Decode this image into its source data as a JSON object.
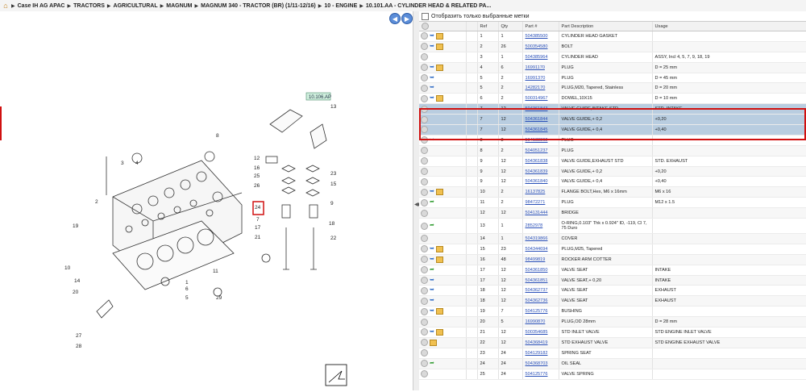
{
  "breadcrumb": {
    "items": [
      "Case IH AG APAC",
      "TRACTORS",
      "AGRICULTURAL",
      "MAGNUM",
      "MAGNUM 340 - TRACTOR (BR) (1/11-12/16)",
      "10 - ENGINE",
      "10.101.AA - CYLINDER HEAD & RELATED PA..."
    ]
  },
  "diagram": {
    "ref_label": "10.106.AP",
    "callouts": [
      "1",
      "2",
      "3",
      "4",
      "5",
      "6",
      "7",
      "8",
      "9",
      "10",
      "11",
      "12",
      "13",
      "14",
      "15",
      "16",
      "17",
      "18",
      "19",
      "20",
      "21",
      "22",
      "23",
      "24",
      "25",
      "26",
      "27",
      "28",
      "29"
    ]
  },
  "right": {
    "filter_label": "Отобразить только выбранные метки",
    "columns": [
      "Ref",
      "Qty",
      "Part #",
      "Part Description",
      "Usage"
    ],
    "rows": [
      {
        "ref": "1",
        "qty": "1",
        "part": "504385500",
        "desc": "CYLINDER HEAD GASKET",
        "usage": "",
        "icons": [
          "arrow",
          "box"
        ]
      },
      {
        "ref": "2",
        "qty": "26",
        "part": "500354580",
        "desc": "BOLT",
        "usage": "",
        "icons": [
          "arrow",
          "box"
        ]
      },
      {
        "ref": "3",
        "qty": "1",
        "part": "504385964",
        "desc": "CYLINDER HEAD",
        "usage": "ASSY, Incl 4, 5, 7, 9, 18, 19",
        "icons": []
      },
      {
        "ref": "4",
        "qty": "6",
        "part": "16991170",
        "desc": "PLUG",
        "usage": "D = 25 mm",
        "icons": [
          "arrow",
          "box"
        ]
      },
      {
        "ref": "5",
        "qty": "2",
        "part": "16991370",
        "desc": "PLUG",
        "usage": "D = 45 mm",
        "icons": [
          "arrow"
        ]
      },
      {
        "ref": "5",
        "qty": "2",
        "part": "14282170",
        "desc": "PLUG,M20, Tapered, Stainless",
        "usage": "D = 20 mm",
        "icons": [
          "arrow"
        ]
      },
      {
        "ref": "6",
        "qty": "2",
        "part": "500314967",
        "desc": "DOWEL,10X15",
        "usage": "D = 10 mm",
        "icons": [
          "arrow",
          "box"
        ]
      },
      {
        "ref": "7",
        "qty": "12",
        "part": "504361843",
        "desc": "VALVE GUIDE,INTAKE STD",
        "usage": "STD. INTAKE",
        "icons": [],
        "sel": true
      },
      {
        "ref": "7",
        "qty": "12",
        "part": "504361844",
        "desc": "VALVE GUIDE,+ 0,2",
        "usage": "+0,20",
        "icons": [],
        "sel": true
      },
      {
        "ref": "7",
        "qty": "12",
        "part": "504361845",
        "desc": "VALVE GUIDE,+ 0,4",
        "usage": "+0,40",
        "icons": [],
        "sel": true
      },
      {
        "ref": "8",
        "qty": "3",
        "part": "504138862",
        "desc": "PLUG",
        "usage": "",
        "icons": [
          "arrow"
        ]
      },
      {
        "ref": "8",
        "qty": "2",
        "part": "504051237",
        "desc": "PLUG",
        "usage": "",
        "icons": []
      },
      {
        "ref": "9",
        "qty": "12",
        "part": "504361838",
        "desc": "VALVE GUIDE,EXHAUST STD",
        "usage": "STD. EXHAUST",
        "icons": []
      },
      {
        "ref": "9",
        "qty": "12",
        "part": "504361839",
        "desc": "VALVE GUIDE,+ 0,2",
        "usage": "+0,20",
        "icons": []
      },
      {
        "ref": "9",
        "qty": "12",
        "part": "504361840",
        "desc": "VALVE GUIDE,+ 0,4",
        "usage": "+0,40",
        "icons": []
      },
      {
        "ref": "10",
        "qty": "2",
        "part": "16137825",
        "desc": "FLANGE BOLT,Hex, M6 x 16mm",
        "usage": "M6 x 16",
        "icons": [
          "arrow",
          "box"
        ]
      },
      {
        "ref": "11",
        "qty": "2",
        "part": "98472271",
        "desc": "PLUG",
        "usage": "M12 x 1.5",
        "icons": [
          "green"
        ]
      },
      {
        "ref": "12",
        "qty": "12",
        "part": "504131444",
        "desc": "BRIDGE",
        "usage": "",
        "icons": []
      },
      {
        "ref": "13",
        "qty": "1",
        "part": "2852978",
        "desc": "O-RING,0.103\" Thk x 0.924\" ID, -119, Cl 7, 75 Duro",
        "usage": "",
        "icons": [
          "green"
        ],
        "tall": true
      },
      {
        "ref": "14",
        "qty": "1",
        "part": "504319866",
        "desc": "COVER",
        "usage": "",
        "icons": []
      },
      {
        "ref": "15",
        "qty": "23",
        "part": "504344694",
        "desc": "PLUG,M25, Tapered",
        "usage": "",
        "icons": [
          "arrow",
          "box"
        ]
      },
      {
        "ref": "16",
        "qty": "48",
        "part": "98499819",
        "desc": "ROCKER ARM COTTER",
        "usage": "",
        "icons": [
          "arrow",
          "box"
        ]
      },
      {
        "ref": "17",
        "qty": "12",
        "part": "504361850",
        "desc": "VALVE SEAT",
        "usage": "INTAKE",
        "icons": [
          "green"
        ]
      },
      {
        "ref": "17",
        "qty": "12",
        "part": "504361851",
        "desc": "VALVE SEAT,+ 0,20",
        "usage": "INTAKE",
        "icons": [
          "arrow"
        ]
      },
      {
        "ref": "18",
        "qty": "12",
        "part": "504362737",
        "desc": "VALVE SEAT",
        "usage": "EXHAUST",
        "icons": [
          "arrow"
        ]
      },
      {
        "ref": "18",
        "qty": "12",
        "part": "504362736",
        "desc": "VALVE SEAT",
        "usage": "EXHAUST",
        "icons": [
          "arrow"
        ]
      },
      {
        "ref": "19",
        "qty": "7",
        "part": "504125776",
        "desc": "BUSHING",
        "usage": "",
        "icons": [
          "arrow",
          "box"
        ]
      },
      {
        "ref": "20",
        "qty": "5",
        "part": "16990870",
        "desc": "PLUG,OD 28mm",
        "usage": "D = 28 mm",
        "icons": []
      },
      {
        "ref": "21",
        "qty": "12",
        "part": "500354685",
        "desc": "STD INLET VALVE",
        "usage": "STD ENGINE INLET VALVE",
        "icons": [
          "arrow",
          "box"
        ]
      },
      {
        "ref": "22",
        "qty": "12",
        "part": "504368419",
        "desc": "STD EXHAUST VALVE",
        "usage": "STD ENGINE EXHAUST VALVE",
        "icons": [
          "box"
        ]
      },
      {
        "ref": "23",
        "qty": "24",
        "part": "504129182",
        "desc": "SPRING SEAT",
        "usage": "",
        "icons": []
      },
      {
        "ref": "24",
        "qty": "24",
        "part": "504368703",
        "desc": "OIL SEAL",
        "usage": "",
        "icons": [
          "green"
        ]
      },
      {
        "ref": "25",
        "qty": "24",
        "part": "504125776",
        "desc": "VALVE SPRING",
        "usage": "",
        "icons": []
      }
    ]
  }
}
